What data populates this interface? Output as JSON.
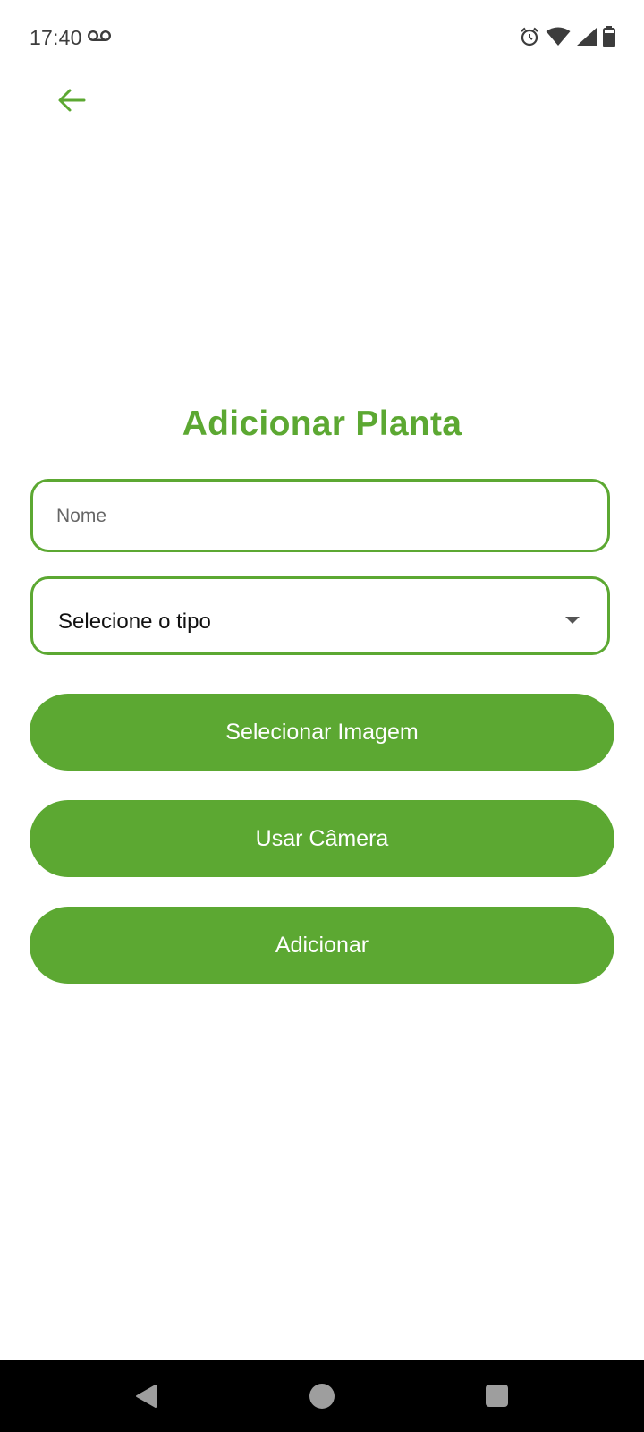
{
  "status_bar": {
    "time": "17:40",
    "icons": [
      "voicemail-icon",
      "alarm-icon",
      "wifi-icon",
      "signal-icon",
      "battery-icon"
    ]
  },
  "header": {
    "back_icon": "arrow-left-icon"
  },
  "form": {
    "title": "Adicionar Planta",
    "name_placeholder": "Nome",
    "name_value": "",
    "type_select_label": "Selecione o tipo",
    "select_image_label": "Selecionar Imagem",
    "use_camera_label": "Usar Câmera",
    "add_label": "Adicionar"
  },
  "nav_bar": {
    "buttons": [
      "nav-back-icon",
      "nav-home-icon",
      "nav-recents-icon"
    ]
  },
  "colors": {
    "accent": "#5ca832",
    "background": "#ffffff",
    "nav_bar": "#000000"
  }
}
